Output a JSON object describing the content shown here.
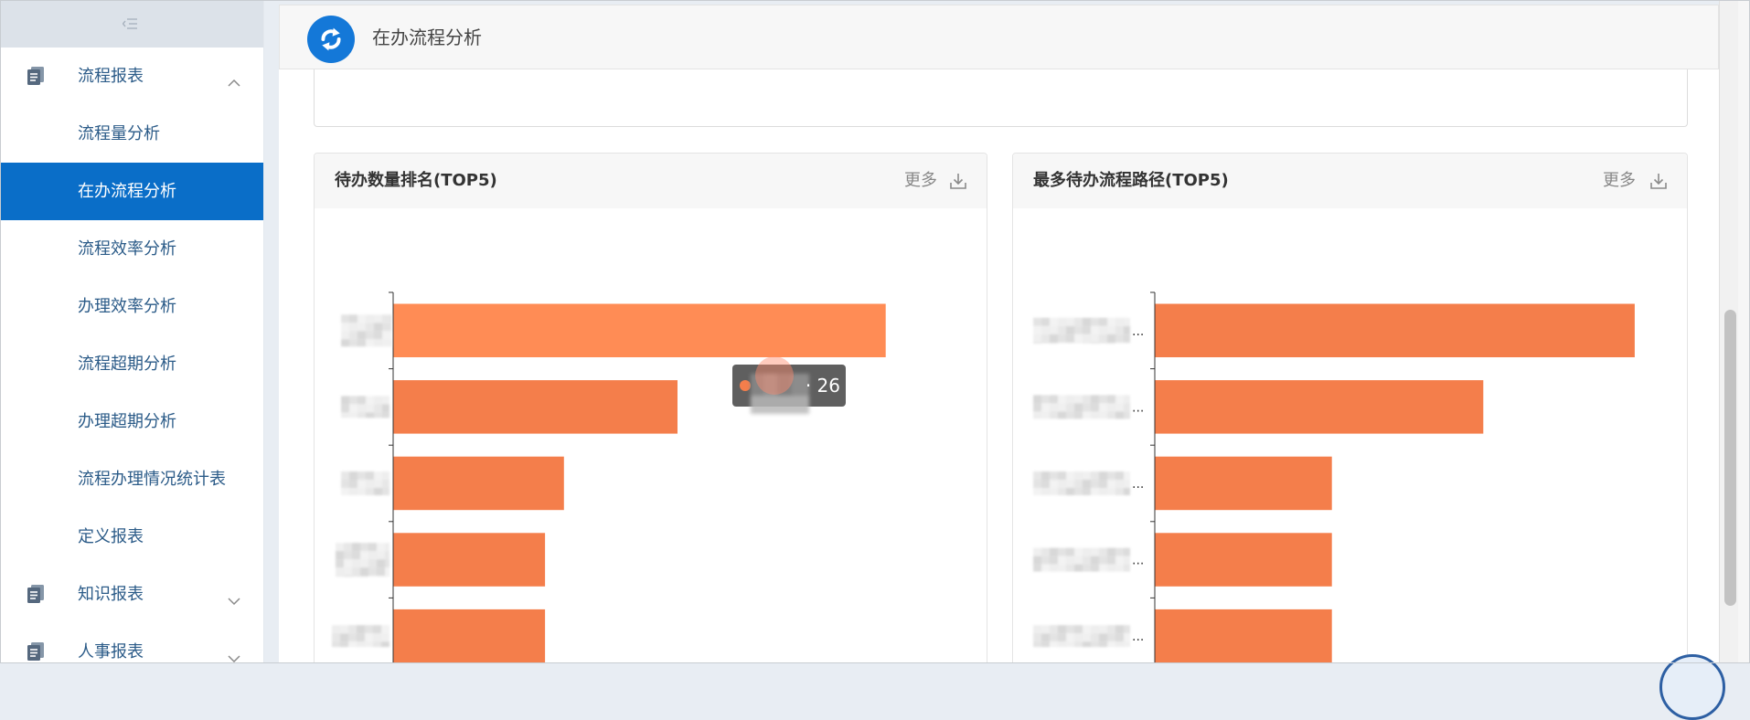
{
  "sidebar": {
    "collapse_icon": "menu-fold-icon",
    "groups": [
      {
        "label": "流程报表",
        "icon": "report-document-icon",
        "expanded": true,
        "items": [
          {
            "label": "流程量分析"
          },
          {
            "label": "在办流程分析",
            "active": true
          },
          {
            "label": "流程效率分析"
          },
          {
            "label": "办理效率分析"
          },
          {
            "label": "流程超期分析"
          },
          {
            "label": "办理超期分析"
          },
          {
            "label": "流程办理情况统计表"
          },
          {
            "label": "定义报表"
          }
        ]
      },
      {
        "label": "知识报表",
        "icon": "report-document-icon",
        "expanded": false
      },
      {
        "label": "人事报表",
        "icon": "report-document-icon",
        "expanded": false
      }
    ]
  },
  "header": {
    "title": "在办流程分析",
    "icon": "process-sync-icon"
  },
  "cards": [
    {
      "more_label": "更多",
      "download_icon": "download-icon"
    },
    {
      "more_label": "更多",
      "download_icon": "download-icon"
    }
  ],
  "colors": {
    "accent": "#0a6ec8",
    "header_icon": "#1478d8",
    "sidebar_text": "#2b5b88",
    "bar": "#f47e4b",
    "bar_highlight": "#ff8c55",
    "axis": "#333333"
  },
  "chart_data": [
    {
      "type": "bar",
      "orientation": "horizontal",
      "title": "待办数量排名(TOP5)",
      "values": [
        26,
        15,
        9,
        8,
        8
      ],
      "xlim": [
        0,
        30
      ],
      "highlighted_index": 0,
      "tooltip": {
        "text": "· 26"
      }
    },
    {
      "type": "bar",
      "orientation": "horizontal",
      "title": "最多待办流程路径(TOP5)",
      "categories": [
        "...",
        "...",
        "...",
        "...",
        "..."
      ],
      "values": [
        19,
        13,
        7,
        7,
        7
      ],
      "xlim": [
        0,
        20
      ]
    }
  ]
}
